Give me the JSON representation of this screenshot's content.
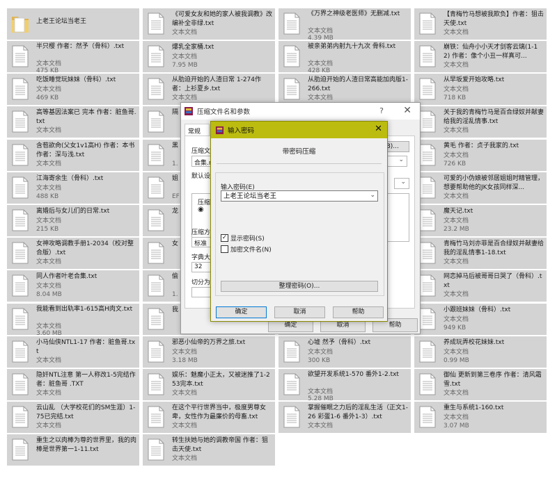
{
  "files": [
    {
      "name": "上老王论坛当老王",
      "type": "",
      "size": "",
      "kind": "folder"
    },
    {
      "name": "《可爱女友和她的家人被我调教》改编补全非绿.txt",
      "type": "文本文档",
      "size": ""
    },
    {
      "name": "《万界之神级老医师》无删减.txt",
      "type": "文本文档",
      "size": "4.39 MB"
    },
    {
      "name": "【青梅竹马想被我欺负】作者：狙击天使.txt",
      "type": "文本文档",
      "size": ""
    },
    {
      "name": "半只樱 作者：然予（骨科）.txt",
      "type": "文本文档",
      "size": "475 KB"
    },
    {
      "name": "爆乳全家桶.txt",
      "type": "文本文档",
      "size": "7.95 MB"
    },
    {
      "name": "被亲弟弟内射九十九次 骨科.txt",
      "type": "文本文档",
      "size": "428 KB"
    },
    {
      "name": "崩铁：仙舟小小天才剑客云璃(1-12) 作者：像个小丑一样真可...",
      "type": "文本文档",
      "size": ""
    },
    {
      "name": "吃饭睡觉玩妹妹（骨科）.txt",
      "type": "文本文档",
      "size": "469 KB"
    },
    {
      "name": "从肋迫开始的人渣日常 1-274作者：上衫夏乡.txt",
      "type": "文本文档",
      "size": ""
    },
    {
      "name": "从肋迫开始的人渣日常高能加肉版1-266.txt",
      "type": "文本文档",
      "size": ""
    },
    {
      "name": "从早坂爱开始攻略.txt",
      "type": "文本文档",
      "size": "718 KB"
    },
    {
      "name": "高等基因法案已 完本 作者：脏鱼哥.txt",
      "type": "文本文档",
      "size": ""
    },
    {
      "name": "隔",
      "type": "",
      "size": ""
    },
    {
      "name": "",
      "type": "",
      "size": ""
    },
    {
      "name": "关于我的青梅竹马是百合绿奴并献妻给我的淫乱情事.txt",
      "type": "文本文档",
      "size": ""
    },
    {
      "name": "含苞欲肏(父女1v1高H) 作者：本书作者：深与浅.txt",
      "type": "文本文档",
      "size": ""
    },
    {
      "name": "黑",
      "type": "",
      "size": "1."
    },
    {
      "name": "",
      "type": "",
      "size": ""
    },
    {
      "name": "黄毛 作者：贞子我家的.txt",
      "type": "文本文档",
      "size": "726 KB"
    },
    {
      "name": "江海寄余生（骨科）.txt",
      "type": "文本文档",
      "size": "488 KB"
    },
    {
      "name": "姐",
      "type": "",
      "size": "EF"
    },
    {
      "name": "",
      "type": "",
      "size": ""
    },
    {
      "name": "可爱的小伪娘被邻居姐姐时精管理，想要帮助他的JK女孩同样深...",
      "type": "文本文档",
      "size": ""
    },
    {
      "name": "离婚后与女儿们的日常.txt",
      "type": "文本文档",
      "size": "215 KB"
    },
    {
      "name": "龙",
      "type": "",
      "size": ""
    },
    {
      "name": "",
      "type": "",
      "size": ""
    },
    {
      "name": "魔天记.txt",
      "type": "文本文档",
      "size": "23.2 MB"
    },
    {
      "name": "女神攻略调教手册1-2034（校对整合版）.txt",
      "type": "文本文档",
      "size": ""
    },
    {
      "name": "女",
      "type": "",
      "size": ""
    },
    {
      "name": "",
      "type": "",
      "size": ""
    },
    {
      "name": "青梅竹马刘亦菲是百合绿奴并献妻给我的淫乱情事1-18.txt",
      "type": "文本文档",
      "size": ""
    },
    {
      "name": "同人作者叶老合集.txt",
      "type": "文本文档",
      "size": "8.04 MB"
    },
    {
      "name": "偷",
      "type": "",
      "size": "1."
    },
    {
      "name": "",
      "type": "",
      "size": ""
    },
    {
      "name": "网恋掉马后被哥哥日哭了（骨科）.txt",
      "type": "文本文档",
      "size": ""
    },
    {
      "name": "我能看到出轨率1-615高H肉文.txt",
      "type": "文本文档",
      "size": "3.60 MB"
    },
    {
      "name": "我",
      "type": "",
      "size": ""
    },
    {
      "name": "",
      "type": "",
      "size": ""
    },
    {
      "name": "小跟班妹妹（骨科）.txt",
      "type": "文本文档",
      "size": "949 KB"
    },
    {
      "name": "小马仙侠NTL1-17 作者：脏鱼哥.txt",
      "type": "文本文档",
      "size": ""
    },
    {
      "name": "邪恶小仙帝的万界之旅.txt",
      "type": "文本文档",
      "size": "3.18 MB"
    },
    {
      "name": "心墟 然予（骨科）.txt",
      "type": "文本文档",
      "size": "300 KB"
    },
    {
      "name": "养成玩弄校花妹妹.txt",
      "type": "文本文档",
      "size": "0.99 MB"
    },
    {
      "name": "隐奸NTL注意 第一人称改1-5完结作者：脏鱼哥 .TXT",
      "type": "文本文档",
      "size": ""
    },
    {
      "name": "娱乐：魅魔小正太，又被迷推了1-253完本.txt",
      "type": "文本文档",
      "size": ""
    },
    {
      "name": "欲望开发系统1-570 番外1-2.txt",
      "type": "文本文档",
      "size": "5.28 MB"
    },
    {
      "name": "御仙 更新到第三卷序 作者：清风霜雪.txt",
      "type": "文本文档",
      "size": ""
    },
    {
      "name": "云山乱 （大学校花们的SM生涯）1-75已完结.txt",
      "type": "文本文档",
      "size": ""
    },
    {
      "name": "在这个平行世界当中，极度男尊女卑，女性作为最廉价的母畜.txt",
      "type": "文本文档",
      "size": ""
    },
    {
      "name": "掌握催眠之力后的淫乱生活（正文1-26 彩蛋1-6 番外1-3）.txt",
      "type": "文本文档",
      "size": ""
    },
    {
      "name": "重生与系统1-160.txt",
      "type": "文本文档",
      "size": "3.07 MB"
    },
    {
      "name": "重生之以肉棒为尊的世界里，我的肉棒是世界第一1-11.txt",
      "type": "",
      "size": ""
    },
    {
      "name": "转生扶她与她的调教帝国 作者：狙击天使.txt",
      "type": "文本文档",
      "size": ""
    }
  ],
  "bg_dialog": {
    "title": "压缩文件名和参数",
    "help": "?",
    "close": "✕",
    "tab_general": "常规",
    "lbl_archive": "压缩文",
    "archive_value": "合集.r",
    "browse": "(B)...",
    "lbl_default": "默认设",
    "lbl_format": "压缩",
    "lbl_method": "压缩方",
    "method_value": "标准",
    "lbl_dict": "字典大",
    "dict_value": "32",
    "lbl_split": "切分为",
    "btn_ok": "确定",
    "btn_cancel": "取消",
    "btn_help": "帮助"
  },
  "pw_dialog": {
    "title": "输入密码",
    "close": "✕",
    "heading": "带密码压缩",
    "label_password": "输入密码(E)",
    "password_value": "上老王论坛当老王",
    "show_password": "显示密码(S)",
    "show_password_checked": true,
    "encrypt_names": "加密文件名(N)",
    "encrypt_names_checked": false,
    "organize": "整理密码(O)...",
    "ok": "确定",
    "cancel": "取消",
    "help": "帮助"
  }
}
